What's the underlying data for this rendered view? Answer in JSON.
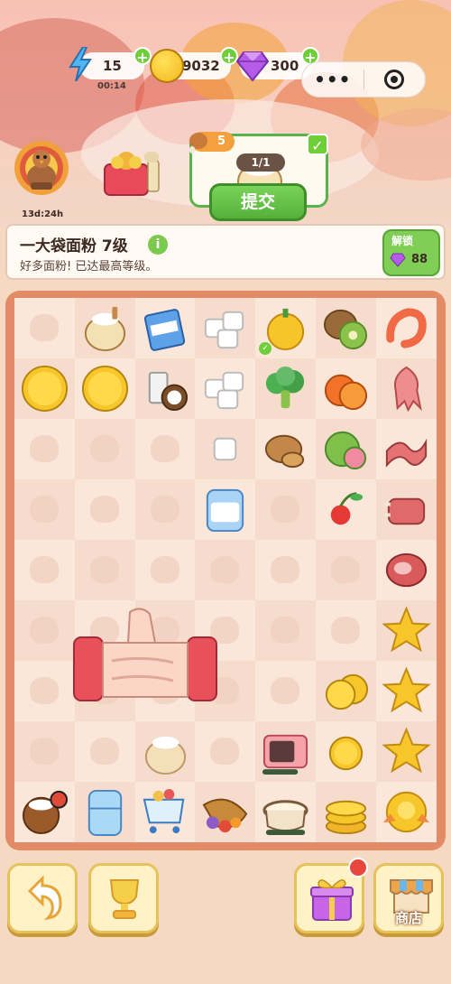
{
  "resources": {
    "energy": "15",
    "energy_timer": "00:14",
    "coins": "9032",
    "gems": "300",
    "plus": "+"
  },
  "capsule": {
    "more": "•••"
  },
  "event": {
    "timer": "13d:24h"
  },
  "order": {
    "badge_count": "5",
    "progress": "1/1",
    "submit_label": "提交",
    "check": "✓"
  },
  "info": {
    "title": "一大袋面粉 7级",
    "info_icon": "i",
    "description": "好多面粉!  已达最高等级。",
    "unlock_label": "解锁",
    "unlock_cost": "88"
  },
  "buttons": {
    "shop_label": "商店"
  },
  "colors": {
    "accent_green": "#6fcf3a",
    "board_orange": "#e28b66",
    "gold": "#f4b51c"
  },
  "board": [
    [
      "empty",
      "flour-sack",
      "cream-carton",
      "sugar-cubes",
      "bell-pepper",
      "kiwi",
      "shrimp"
    ],
    [
      "gold-coin",
      "gold-coin",
      "coconut-milk",
      "sugar-cubes",
      "broccoli",
      "persimmon",
      "squid"
    ],
    [
      "empty",
      "empty",
      "empty",
      "sugar-cube",
      "potato",
      "guava",
      "bacon"
    ],
    [
      "empty",
      "empty",
      "empty",
      "sugar-bag",
      "empty",
      "cherry",
      "ribs"
    ],
    [
      "empty",
      "empty",
      "empty",
      "empty",
      "empty",
      "empty",
      "steak"
    ],
    [
      "empty",
      "empty",
      "empty",
      "empty",
      "empty",
      "empty",
      "star"
    ],
    [
      "empty",
      "empty",
      "empty",
      "empty",
      "empty",
      "coin-pair",
      "star"
    ],
    [
      "empty",
      "empty",
      "flour-sack-selected",
      "empty",
      "microwave",
      "gold-coin-small",
      "star"
    ],
    [
      "flour-jar",
      "fridge",
      "shopping-cart",
      "cornucopia",
      "pot",
      "coin-stack",
      "golden-ribbon"
    ]
  ]
}
